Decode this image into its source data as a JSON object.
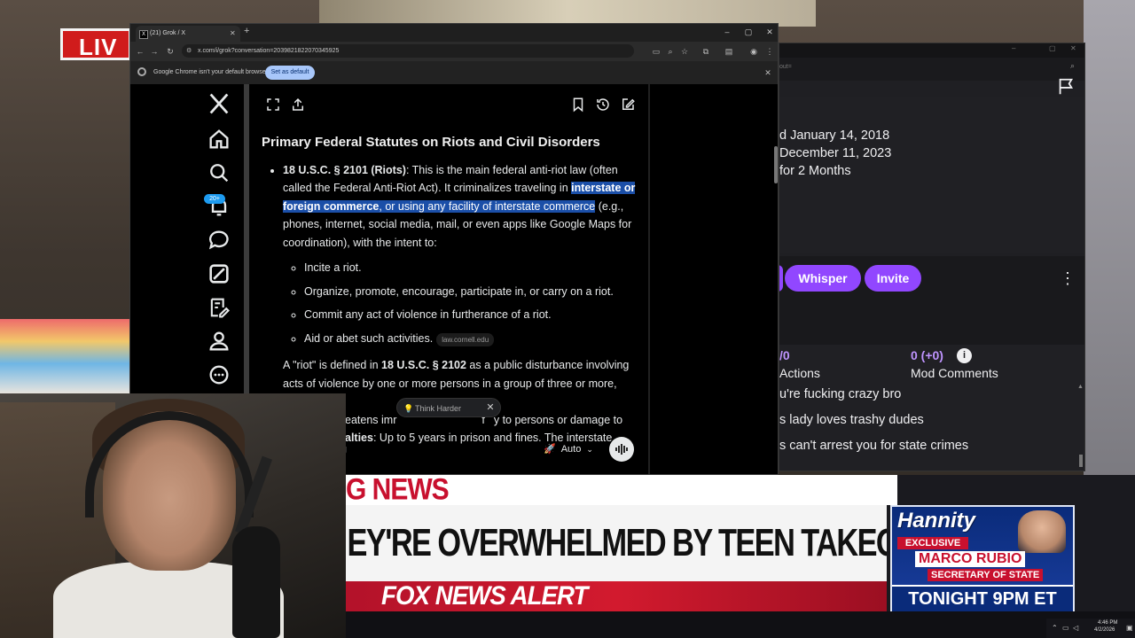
{
  "stream": {
    "live_badge": "LIV"
  },
  "browser": {
    "tab_title": "(21) Grok / X",
    "url": "x.com/i/grok?conversation=2039821822070345925",
    "infobar_text": "Google Chrome isn't your default browser",
    "set_default_label": "Set as default"
  },
  "x_nav": {
    "notification_count": "20+"
  },
  "grok": {
    "heading": "Primary Federal Statutes on Riots and Civil Disorders",
    "bullet1_label": "18 U.S.C. § 2101 (Riots)",
    "bullet1_text_a": ": This is the main federal anti-riot law (often called the Federal Anti-Riot Act). It criminalizes traveling in ",
    "bullet1_hl_bold": "interstate or foreign commerce",
    "bullet1_hl_plain": ", or using any facility of interstate commerce",
    "bullet1_text_b": " (e.g., phones, internet, social media, mail, or even apps like Google Maps for coordination), with the intent to:",
    "sub_items": [
      "Incite a riot.",
      "Organize, promote, encourage, participate in, or carry on a riot.",
      "Commit any act of violence in furtherance of a riot.",
      "Aid or abet such activities."
    ],
    "source_chip": "law.cornell.edu",
    "para2_a": "A \"riot\" is defined in ",
    "para2_bold": "18 U.S.C. § 2102",
    "para2_b": " as a public disturbance involving acts of violence by one or more persons in a group of three or more, which",
    "para2_c": "eatens imr",
    "para2_d": "f",
    "para2_e": "y to persons or damage to",
    "para2_f": "alties",
    "para2_g": ": Up to 5 years in prison and fines. The interstate",
    "think_harder_label": "Think Harder",
    "composer_placeholder": "g",
    "mode_label": "Auto"
  },
  "mod_window": {
    "url_fragment": "out=",
    "date_lines": [
      "d January 14, 2018",
      "December 11, 2023",
      "for 2 Months"
    ],
    "whisper_label": "Whisper",
    "invite_label": "Invite",
    "stat1_value": "/0",
    "stat1_label": "Actions",
    "stat2_value": "0 (+0)",
    "stat2_label": "Mod Comments",
    "chat_lines": [
      "u're fucking crazy bro",
      "s lady loves trashy dudes",
      "s can't arrest you for state crimes"
    ]
  },
  "news": {
    "breaking": "G NEWS",
    "headline": "EY'RE OVERWHELMED BY TEEN TAKEOVERS",
    "alert": "FOX NEWS ALERT",
    "promo_show": "Hannity",
    "promo_exclusive": "EXCLUSIVE",
    "promo_name": "MARCO RUBIO",
    "promo_title": "SECRETARY OF STATE",
    "promo_time": "TONIGHT 9PM ET"
  },
  "taskbar": {
    "time": "4:46 PM",
    "date": "4/2/2026"
  },
  "colors": {
    "twitch_purple": "#9147ff",
    "selection_blue": "#1b4fa8",
    "fox_red": "#c8102e",
    "x_blue": "#1d9bf0"
  }
}
